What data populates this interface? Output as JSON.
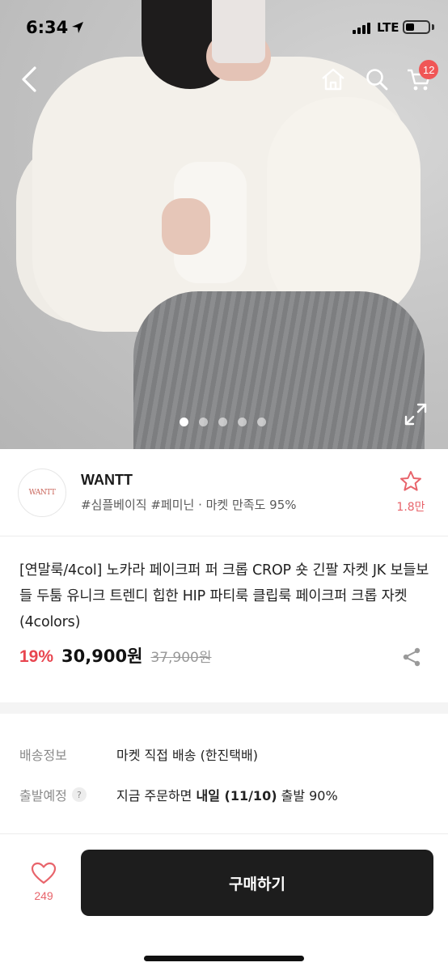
{
  "status_bar": {
    "time": "6:34",
    "network": "LTE"
  },
  "nav": {
    "cart_count": "12"
  },
  "gallery": {
    "image_count": 5,
    "active_index": 0
  },
  "seller": {
    "logo_text": "WANTT",
    "name": "WANTT",
    "tags": "#심플베이직 #페미닌 · 마켓 만족도 95%",
    "favorite_count": "1.8만"
  },
  "product": {
    "title": "[연말룩/4col] 노카라 페이크퍼 퍼 크롭 CROP 숏 긴팔 자켓 JK 보들보들 두툼 유니크 트렌디 힙한 HIP 파티룩 클립룩 페이크퍼 크롭 자켓 (4colors)",
    "discount": "19%",
    "price": "30,900원",
    "original_price": "37,900원"
  },
  "shipping": {
    "delivery_label": "배송정보",
    "delivery_value": "마켓 직접 배송 (한진택배)",
    "dispatch_label": "출발예정",
    "dispatch_help": "?",
    "dispatch_prefix": "지금 주문하면 ",
    "dispatch_bold": "내일 (11/10)",
    "dispatch_suffix": " 출발 90%"
  },
  "bottom": {
    "like_count": "249",
    "buy_label": "구매하기"
  },
  "colors": {
    "accent": "#e8454f",
    "badge": "#f05656",
    "buy_button": "#1d1d1d"
  }
}
